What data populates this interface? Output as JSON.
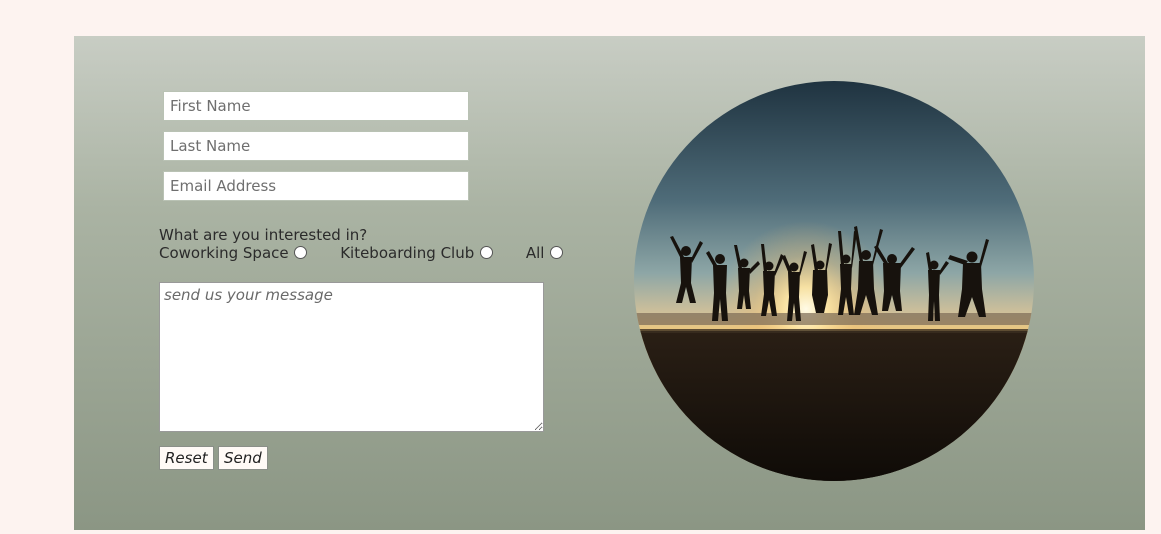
{
  "form": {
    "first_name_placeholder": "First Name",
    "last_name_placeholder": "Last Name",
    "email_placeholder": "Email Address",
    "interest_question": "What are you interested in?",
    "interest_options": [
      {
        "label": "Coworking Space",
        "selected": false
      },
      {
        "label": "Kiteboarding Club",
        "selected": false
      },
      {
        "label": "All",
        "selected": false
      }
    ],
    "message_placeholder": "send us your message",
    "reset_label": "Reset",
    "send_label": "Send"
  },
  "photo": {
    "subject": "group of people jumping silhouetted against sunset on a beach"
  },
  "colors": {
    "page_background": "#fdf3f0",
    "panel_top": "#c8cdc4",
    "panel_bottom": "#8b9684"
  }
}
